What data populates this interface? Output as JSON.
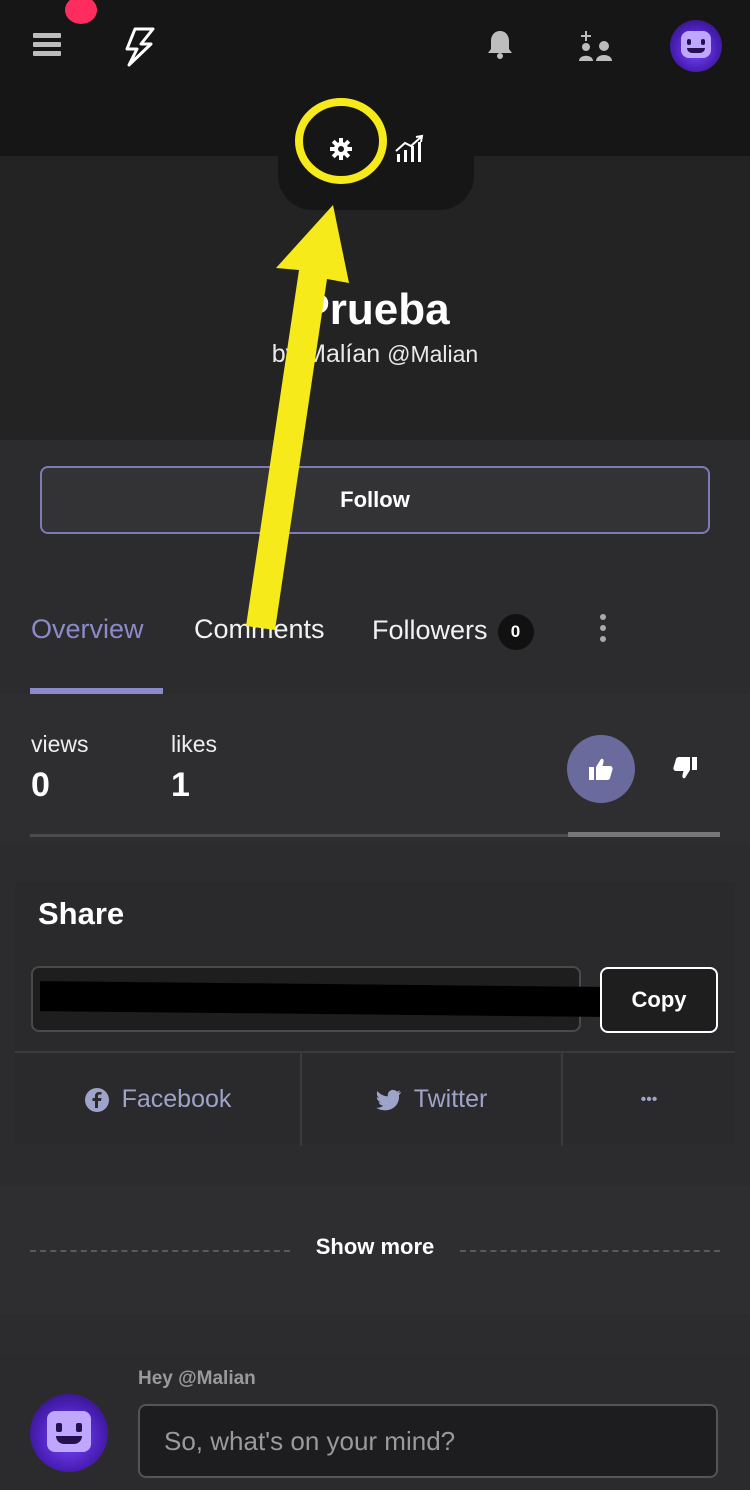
{
  "header": {
    "menu_icon": "hamburger-menu-icon",
    "logo_icon": "lightning-logo-icon",
    "notifications_icon": "bell-icon",
    "people_icon": "add-people-icon",
    "avatar_icon": "robot-avatar-icon",
    "accent_color": "#ff2d5e"
  },
  "notch": {
    "settings_icon": "gear-icon",
    "stats_icon": "stats-chart-icon"
  },
  "post": {
    "title": "Prueba",
    "by": "by",
    "author_name": "Malían",
    "author_handle": "@Malian"
  },
  "follow_button": "Follow",
  "tabs": [
    {
      "label": "Overview",
      "active": true
    },
    {
      "label": "Comments",
      "active": false
    },
    {
      "label": "Followers",
      "active": false,
      "count": "0"
    }
  ],
  "stats": {
    "views_label": "views",
    "views_value": "0",
    "likes_label": "likes",
    "likes_value": "1",
    "like_ratio": 0.22
  },
  "share": {
    "title": "Share",
    "copy_label": "Copy",
    "facebook": "Facebook",
    "twitter": "Twitter",
    "more": "•••"
  },
  "show_more": "Show more",
  "composer": {
    "greeting": "Hey @Malian",
    "placeholder": "So, what's on your mind?"
  },
  "colors": {
    "accent_purple": "#8c8bc9",
    "highlight_yellow": "#f7ea1a",
    "link_blue": "#9ea3c9"
  }
}
